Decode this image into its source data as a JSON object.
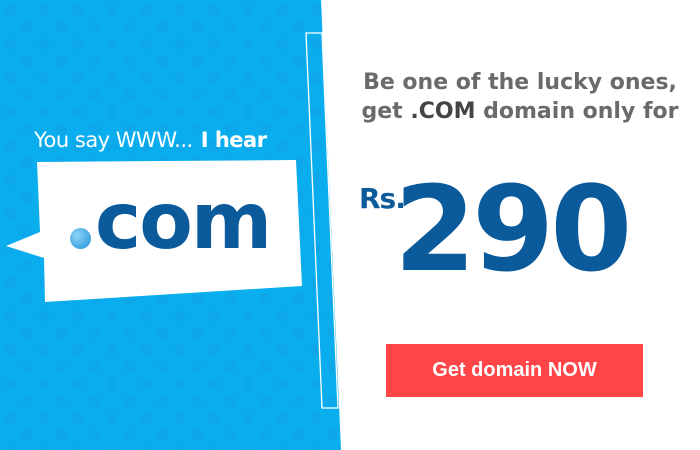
{
  "tagline": {
    "prefix": "You say WWW...",
    "emphasis": "I hear"
  },
  "bubble": {
    "text": "com"
  },
  "headline": {
    "line1": "Be one of the lucky ones,",
    "line2_prefix": "get",
    "line2_domain": ".COM",
    "line2_suffix": "domain only for"
  },
  "price": {
    "currency": "Rs.",
    "amount": "290"
  },
  "cta": {
    "label": "Get domain NOW"
  },
  "colors": {
    "brand_blue": "#0aaeef",
    "dark_blue": "#0a5a9c",
    "cta_red": "#ff4548"
  }
}
